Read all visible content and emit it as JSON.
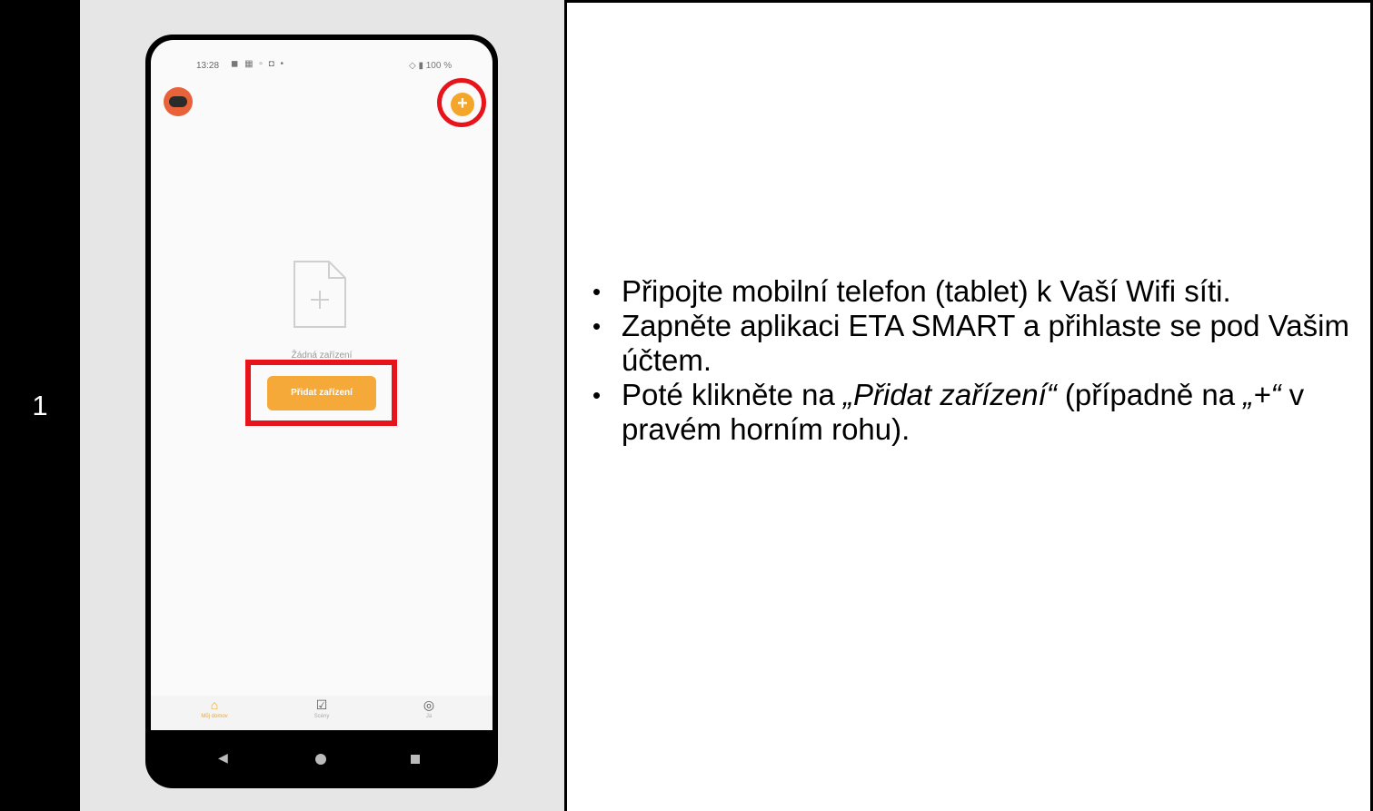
{
  "step": {
    "number": "1"
  },
  "phone": {
    "status_time": "13:28",
    "status_icons": "◼ ▦ ▫ ◘ •",
    "status_right": "◇ ▮ 100 %",
    "empty_text": "Žádná zařízení",
    "add_device_button": "Přidat zařízení",
    "tabs": [
      {
        "icon": "home-icon",
        "label": "Můj domov"
      },
      {
        "icon": "scenes-icon",
        "label": "Scény"
      },
      {
        "icon": "profile-icon",
        "label": "Já"
      }
    ],
    "colors": {
      "accent": "#f5a938",
      "highlight": "#e8141b"
    }
  },
  "instructions": {
    "b1": "Připojte mobilní telefon (tablet) k Vaší Wifi síti.",
    "b2": "Zapněte aplikaci ETA SMART a přihlaste se pod Vašim účtem.",
    "b3_pre": "Poté klikněte na ",
    "b3_italic": "„Přidat zařízení“",
    "b3_mid": " (případně na ",
    "b3_italic2": "„+“",
    "b3_post": " v pravém horním rohu)."
  }
}
